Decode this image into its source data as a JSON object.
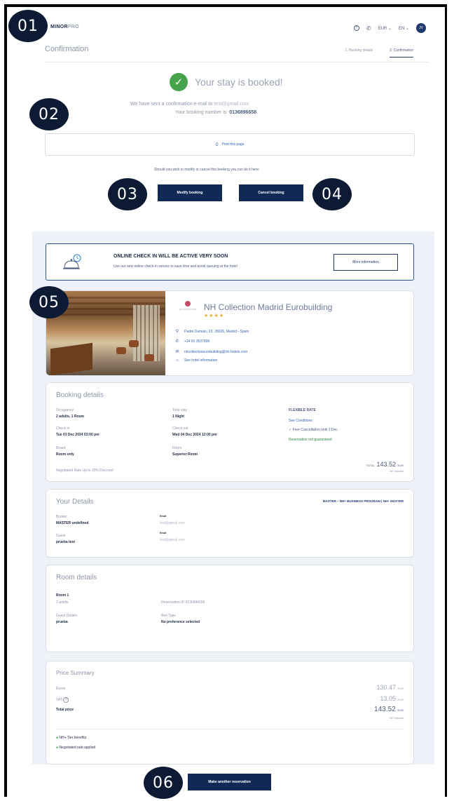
{
  "markers": [
    "01",
    "02",
    "03",
    "04",
    "05",
    "06"
  ],
  "header": {
    "brand_bold": "MINOR",
    "brand_light": "PRO",
    "help_icon": "?",
    "phone_icon": "✆",
    "currency": "EUR",
    "language": "EN",
    "avatar": "JV"
  },
  "page": {
    "title": "Confirmation",
    "steps": [
      "1. Booking details",
      "2. Confirmation"
    ]
  },
  "confirmation": {
    "headline": "Your stay is booked!",
    "email_text": "We have sent a confirmation e-mail to",
    "email": "test@gmail.com",
    "booking_text": "Your booking number is:",
    "booking_number": "0136896658",
    "print_label": "Print this page",
    "modify_text": "Should you wish to modify or cancel this booking you can do it here:",
    "modify_button": "Modify booking",
    "cancel_button": "Cancel booking"
  },
  "checkin": {
    "title": "ONLINE CHECK IN WILL BE ACTIVE VERY SOON",
    "subtitle": "Use our new online check-in service to save time and avoid queuing at the hotel",
    "button": "More information"
  },
  "hotel": {
    "logo_text": "NH COLLECTION",
    "name": "NH Collection Madrid Eurobuilding",
    "stars": "★★★★",
    "address": "Padre Damián, 23, 28036, Madrid - Spain",
    "phone": "+34 91 3537800",
    "email": "nhcollectioneurobuilding@nh-hotels.com",
    "info_link": "See hotel information"
  },
  "booking": {
    "title": "Booking details",
    "occupancy_label": "Occupancy",
    "occupancy": "2 adults, 1 Room",
    "total_stay_label": "Total stay",
    "total_stay": "1 Night",
    "rate_label": "FLEXIBLE RATE",
    "conditions_link": "See Conditions",
    "free_cancel": "✓  Free Cancellation until 3 Dec",
    "not_guaranteed": "Reservation not guaranteed",
    "checkin_label": "Check in",
    "checkin": "Tue 03 Dec 2024 03:00 pm",
    "checkout_label": "Check out",
    "checkout": "Wed 04 Dec 2024 12:00 pm",
    "board_label": "Board",
    "board": "Room only",
    "room_label": "Room",
    "room": "Superior Room",
    "negotiated": "Negotiated Rate Up to 33% Discount",
    "total_label": "TOTAL",
    "total": "143.52",
    "total_currency": "EUR",
    "vat_note": "VAT included"
  },
  "your_details": {
    "title": "Your Details",
    "program": "MASTER – NH+ BUSINESS PROGRAM  |  NH+ MASTER",
    "booker_label": "Booker",
    "booker": "MASTER undefined",
    "guest_label": "Guest",
    "guest": "prueba test",
    "email_label": "Email",
    "email1": "test@gmail.com",
    "email2": "test@gmail.com"
  },
  "room_details": {
    "title": "Room details",
    "room_name": "Room 1",
    "adults": "2 adults",
    "reservation_id": "Reservation ID 0136896658",
    "guest_details_label": "Guest Details",
    "guest_details": "prueba",
    "bed_type_label": "Bed Type",
    "bed_type": "No preference selected"
  },
  "price_summary": {
    "title": "Price Summary",
    "room_label": "Room",
    "room_price": "130.47",
    "vat_label": "VAT",
    "vat_price": "13.05",
    "total_label": "Total price",
    "total_price": "143.52",
    "currency": "EUR",
    "vat_note": "VAT included",
    "benefit1": "NH+ Tier benefits",
    "benefit2": "Negotiated rate applied"
  },
  "footer": {
    "new_reservation": "Make another reservation"
  }
}
